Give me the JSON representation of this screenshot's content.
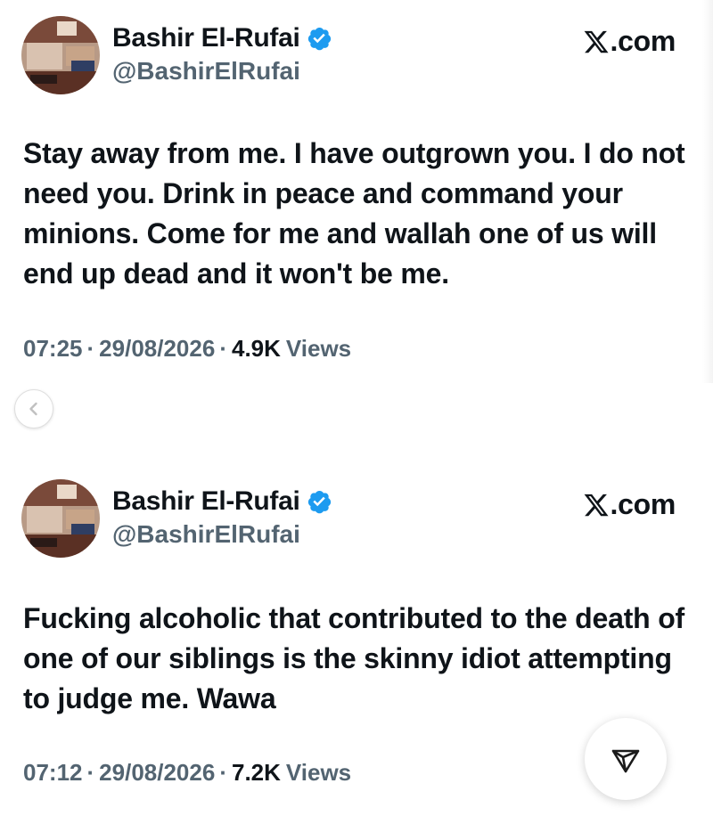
{
  "tweets": [
    {
      "author_name": "Bashir El-Rufai",
      "handle": "@BashirElRufai",
      "brand": ".com",
      "text": "Stay away from me. I have outgrown you. I do not need you. Drink in peace and command your minions. Come for me and wallah one of us will end up dead and it won't be me.",
      "time": "07:25",
      "date": "29/08/2026",
      "views_count": "4.9K",
      "views_label": "Views"
    },
    {
      "author_name": "Bashir El-Rufai",
      "handle": "@BashirElRufai",
      "brand": ".com",
      "text": "Fucking alcoholic that contributed to the death of one of our siblings is the skinny idiot attempting to judge me. Wawa",
      "time": "07:12",
      "date": "29/08/2026",
      "views_count": "7.2K",
      "views_label": "Views"
    }
  ],
  "separator": "·",
  "icons": {
    "verified": "verified-badge-icon",
    "brand": "x-logo-icon",
    "prev": "chevron-left-icon",
    "share": "send-icon"
  },
  "colors": {
    "text": "#0f1419",
    "muted": "#536471",
    "verified": "#1d9bf0"
  }
}
